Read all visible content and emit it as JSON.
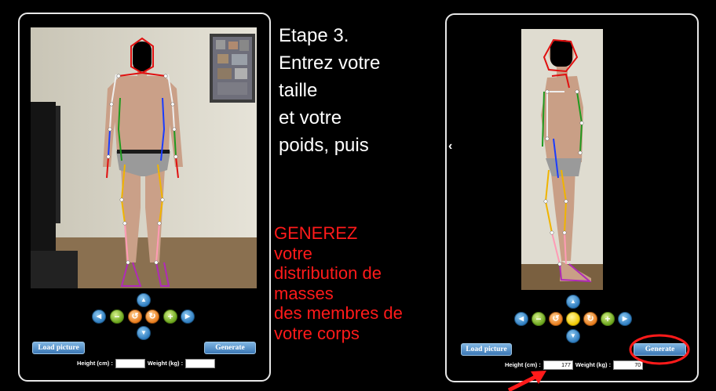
{
  "step": {
    "text": "Etape 3.\nEntrez votre\ntaille\net votre\npoids, puis"
  },
  "callout": {
    "text": "GENEREZ\nvotre\ndistribution de\nmasses\ndes membres de\nvotre corps"
  },
  "left_panel": {
    "load_label": "Load picture",
    "generate_label": "Generate",
    "height_label": "Height (cm) :",
    "weight_label": "Weight (kg) :",
    "height_value": "",
    "weight_value": ""
  },
  "right_panel": {
    "load_label": "Load picture",
    "generate_label": "Generate",
    "height_label": "Height (cm) :",
    "weight_label": "Weight (kg) :",
    "height_value": "177",
    "weight_value": "70"
  },
  "icons": {
    "up": "▲",
    "down": "▼",
    "left": "◀",
    "right": "▶",
    "zoom_out": "−",
    "zoom_in": "+",
    "rotate_left": "↺",
    "rotate_right": "↻",
    "carousel_prev": "‹"
  },
  "colors": {
    "callout": "#ff1a1a",
    "skeleton_red": "#e01010",
    "skeleton_blue": "#1a3cff",
    "skeleton_green": "#1f9a1f",
    "skeleton_yellow": "#f0b400",
    "skeleton_pink": "#ff9bb5",
    "skeleton_purple": "#b02ab8",
    "skeleton_white": "#ffffff"
  }
}
